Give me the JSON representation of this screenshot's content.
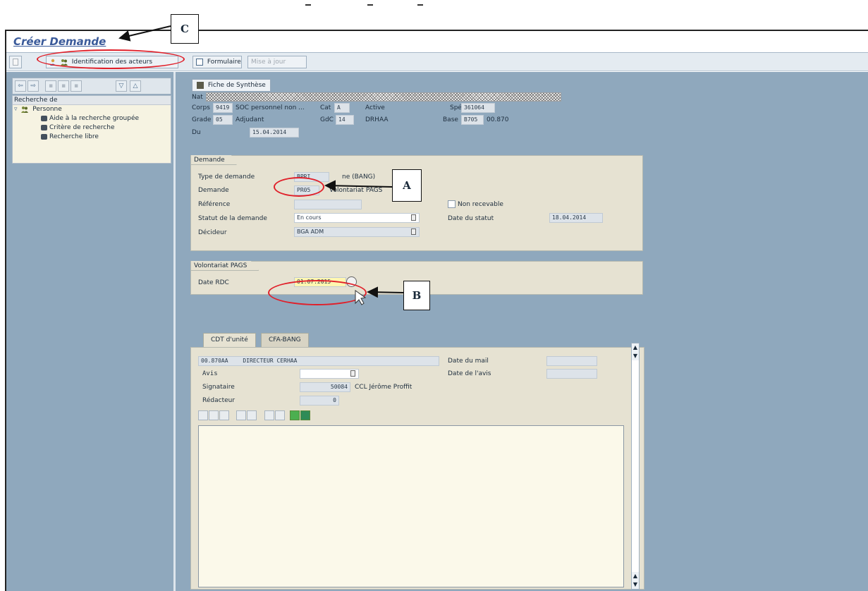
{
  "window": {
    "title": "Créer Demande"
  },
  "toolbar": {
    "identification": "Identification des acteurs",
    "formulaire": "Formulaire",
    "mise_a_jour": "Mise à jour"
  },
  "left": {
    "tree_header": "Recherche de",
    "tree_root": "Personne",
    "tree_items": [
      "Aide à la recherche groupée",
      "Critère de recherche",
      "Recherche libre"
    ]
  },
  "summary": {
    "button": "Fiche de Synthèse",
    "nat_label": "Nat",
    "corps_label": "Corps",
    "corps_code": "9419",
    "corps_text": "SOC personnel non ...",
    "cat_label": "Cat",
    "cat_value": "A",
    "active": "Active",
    "spe_label": "Spé",
    "spe_value": "361064",
    "grade_label": "Grade",
    "grade_code": "05",
    "grade_text": "Adjudant",
    "gdc_label": "GdC",
    "gdc_value": "14",
    "drhaa": "DRHAA",
    "base_label": "Base",
    "base_code": "B705",
    "base_value": "00.870",
    "du_label": "Du",
    "du_value": "15.04.2014"
  },
  "demande": {
    "group": "Demande",
    "type_label": "Type de demande",
    "type_value": "BPRI",
    "type_text": "ne (BANG)",
    "demande_label": "Demande",
    "demande_code": "PR05",
    "demande_text": "Volontariat PAGS",
    "reference_label": "Référence",
    "non_recevable": "Non recevable",
    "statut_label": "Statut de la demande",
    "statut_value": "En cours",
    "date_statut_label": "Date du statut",
    "date_statut_value": "18.04.2014",
    "decideur_label": "Décideur",
    "decideur_value": "BGA ADM"
  },
  "volontariat": {
    "group": "Volontariat PAGS",
    "date_label": "Date RDC",
    "date_value": "01.07.2015"
  },
  "tabs": [
    "CDT d'unité",
    "CFA-BANG"
  ],
  "cdt": {
    "unit_code": "00.870AA",
    "unit_text": "DIRECTEUR CERHAA",
    "date_mail_label": "Date du mail",
    "avis_label": "Avis",
    "date_avis_label": "Date de l'avis",
    "signataire_label": "Signataire",
    "signataire_code": "50084",
    "signataire_name": "CCL Jérôme Proffit",
    "redacteur_label": "Rédacteur",
    "redacteur_value": "0"
  },
  "annotations": {
    "a": "A",
    "b": "B",
    "c": "C"
  },
  "colors": {
    "title": "#3a5a9a",
    "background": "#8fa8bd",
    "highlight": "#e0202a",
    "required_field": "#fff6b0"
  }
}
